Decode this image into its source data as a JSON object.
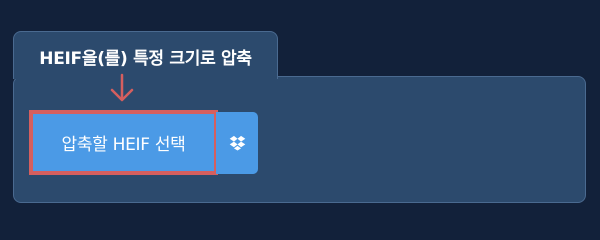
{
  "tab": {
    "title": "HEIF을(를) 특정 크기로 압축"
  },
  "actions": {
    "select_label": "압축할 HEIF 선택",
    "dropbox_icon": "dropbox-icon"
  },
  "colors": {
    "page_background": "#12213a",
    "panel_background": "#2c4a6d",
    "button_background": "#4b9ae6",
    "highlight": "#d55f5f"
  }
}
